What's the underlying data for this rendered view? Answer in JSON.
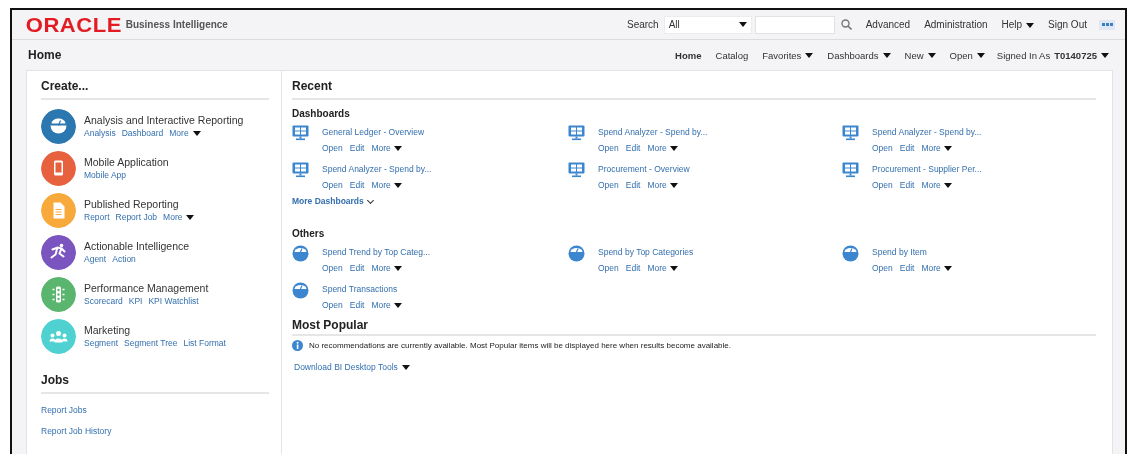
{
  "header": {
    "logo": "ORACLE",
    "product": "Business Intelligence",
    "search_label": "Search",
    "search_scope": "All",
    "links": [
      {
        "label": "Advanced",
        "dropdown": false
      },
      {
        "label": "Administration",
        "dropdown": false
      },
      {
        "label": "Help",
        "dropdown": true
      },
      {
        "label": "Sign Out",
        "dropdown": false
      }
    ]
  },
  "navbar": {
    "title": "Home",
    "items": [
      {
        "label": "Home",
        "selected": true,
        "dropdown": false
      },
      {
        "label": "Catalog",
        "selected": false,
        "dropdown": false
      },
      {
        "label": "Favorites",
        "selected": false,
        "dropdown": true
      },
      {
        "label": "Dashboards",
        "selected": false,
        "dropdown": true
      },
      {
        "label": "New",
        "selected": false,
        "dropdown": true
      },
      {
        "label": "Open",
        "selected": false,
        "dropdown": true
      }
    ],
    "signed_in_label": "Signed In As",
    "user": "T0140725"
  },
  "create": {
    "title": "Create...",
    "items": [
      {
        "name": "Analysis and Interactive Reporting",
        "kind": "analysis",
        "color": "#2b78b0",
        "links": [
          {
            "label": "Analysis",
            "dropdown": false
          },
          {
            "label": "Dashboard",
            "dropdown": false
          },
          {
            "label": "More",
            "dropdown": true
          }
        ]
      },
      {
        "name": "Mobile Application",
        "kind": "mobile",
        "color": "#e8613f",
        "links": [
          {
            "label": "Mobile App",
            "dropdown": false
          }
        ]
      },
      {
        "name": "Published Reporting",
        "kind": "report",
        "color": "#f8a93c",
        "links": [
          {
            "label": "Report",
            "dropdown": false
          },
          {
            "label": "Report Job",
            "dropdown": false
          },
          {
            "label": "More",
            "dropdown": true
          }
        ]
      },
      {
        "name": "Actionable Intelligence",
        "kind": "agent",
        "color": "#7a55c0",
        "links": [
          {
            "label": "Agent",
            "dropdown": false
          },
          {
            "label": "Action",
            "dropdown": false
          }
        ]
      },
      {
        "name": "Performance Management",
        "kind": "scorecard",
        "color": "#5ab66e",
        "links": [
          {
            "label": "Scorecard",
            "dropdown": false
          },
          {
            "label": "KPI",
            "dropdown": false
          },
          {
            "label": "KPI Watchlist",
            "dropdown": false
          }
        ]
      },
      {
        "name": "Marketing",
        "kind": "segment",
        "color": "#4fd1d1",
        "links": [
          {
            "label": "Segment",
            "dropdown": false
          },
          {
            "label": "Segment Tree",
            "dropdown": false
          },
          {
            "label": "List Format",
            "dropdown": false
          }
        ]
      }
    ]
  },
  "jobs": {
    "title": "Jobs",
    "links": [
      "Report Jobs",
      "Report Job History"
    ]
  },
  "recent": {
    "title": "Recent",
    "sections": [
      {
        "title": "Dashboards",
        "kind": "dashboard",
        "more_link": "More Dashboards",
        "items": [
          {
            "title": "General Ledger - Overview",
            "actions": [
              "Open",
              "Edit"
            ],
            "menu": "More"
          },
          {
            "title": "Spend Analyzer - Spend by...",
            "actions": [
              "Open",
              "Edit"
            ],
            "menu": "More"
          },
          {
            "title": "Spend Analyzer - Spend by...",
            "actions": [
              "Open",
              "Edit"
            ],
            "menu": "More"
          },
          {
            "title": "Spend Analyzer - Spend by...",
            "actions": [
              "Open",
              "Edit"
            ],
            "menu": "More"
          },
          {
            "title": "Procurement - Overview",
            "actions": [
              "Open",
              "Edit"
            ],
            "menu": "More"
          },
          {
            "title": "Procurement - Supplier Per...",
            "actions": [
              "Open",
              "Edit"
            ],
            "menu": "More"
          }
        ]
      },
      {
        "title": "Others",
        "kind": "analysis",
        "items": [
          {
            "title": "Spend Trend by Top Categ...",
            "actions": [
              "Open",
              "Edit"
            ],
            "menu": "More"
          },
          {
            "title": "Spend by Top Categories",
            "actions": [
              "Open",
              "Edit"
            ],
            "menu": "More"
          },
          {
            "title": "Spend by Item",
            "actions": [
              "Open",
              "Edit"
            ],
            "menu": "More"
          },
          {
            "title": "Spend Transactions",
            "actions": [
              "Open",
              "Edit"
            ],
            "menu": "More"
          }
        ]
      }
    ]
  },
  "most_popular": {
    "title": "Most Popular",
    "message": "No recommendations are currently available. Most Popular items will be displayed here when results become available.",
    "download": "Download BI Desktop Tools"
  }
}
